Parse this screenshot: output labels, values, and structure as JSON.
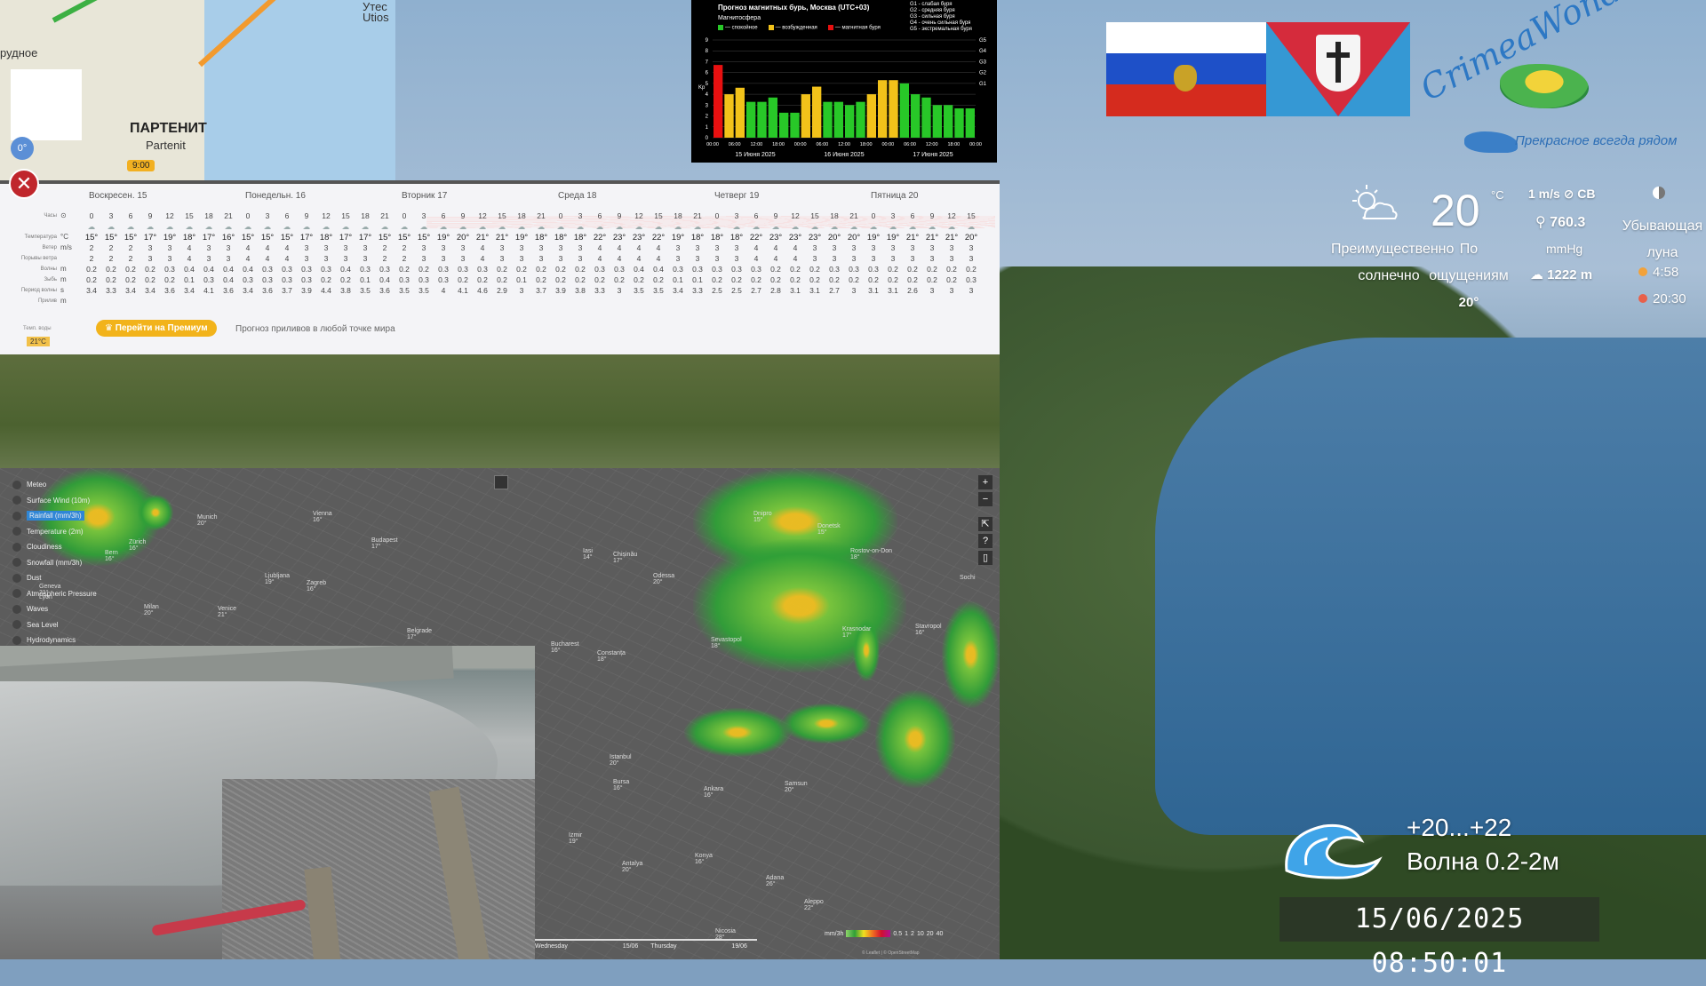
{
  "map": {
    "labels": {
      "town": "ПАРТЕНИТ",
      "town_latin": "Partenit",
      "left_label": "рудное",
      "right_label": "Утес",
      "right_label2": "Utios"
    },
    "temperature": "0°",
    "time_tag": "9:00"
  },
  "kp_chart": {
    "title": "Прогноз магнитных бурь, Москва (UTC+03)",
    "subtitle": "Магнитосфера",
    "legend": [
      "— спокойное",
      "— возбужденная",
      "— магнитная буря"
    ],
    "storm_levels": [
      "G1 - слабая буря",
      "G2 - средняя буря",
      "G3 - сильная буря",
      "G4 - очень сильная буря",
      "G5 - экстремальная буря"
    ],
    "days": [
      "15 Июня 2025",
      "16 Июня 2025",
      "17 Июня 2025"
    ],
    "chart_data": {
      "type": "bar",
      "ylabel": "Kp",
      "ylim": [
        0,
        9
      ],
      "y_ticks": [
        "0",
        "1",
        "2",
        "3",
        "4",
        "5",
        "6",
        "7",
        "8",
        "9"
      ],
      "right_ticks": [
        "G1",
        "G2",
        "G3",
        "G4",
        "G5"
      ],
      "x_ticks": [
        "00:00",
        "06:00",
        "12:00",
        "18:00",
        "00:00",
        "06:00",
        "12:00",
        "18:00",
        "00:00",
        "06:00",
        "12:00",
        "18:00",
        "00:00"
      ],
      "values": [
        6.7,
        4.0,
        4.6,
        3.3,
        3.3,
        3.7,
        2.3,
        2.3,
        4.0,
        4.7,
        3.3,
        3.3,
        3.0,
        3.3,
        4.0,
        5.3,
        5.3,
        5.0,
        4.0,
        3.7,
        3.0,
        3.0,
        2.7,
        2.7
      ],
      "colors": [
        "#e81010",
        "#f2c21a",
        "#f2c21a",
        "#28c828",
        "#28c828",
        "#28c828",
        "#28c828",
        "#28c828",
        "#f2c21a",
        "#f2c21a",
        "#28c828",
        "#28c828",
        "#28c828",
        "#28c828",
        "#f2c21a",
        "#f2c21a",
        "#f2c21a",
        "#28c828",
        "#28c828",
        "#28c828",
        "#28c828",
        "#28c828",
        "#28c828",
        "#28c828"
      ]
    },
    "palette": {
      "quiet": "#28c828",
      "active": "#f2c21a",
      "storm": "#e81010"
    }
  },
  "forecast": {
    "days": [
      "Воскресен. 15",
      "Понедельн. 16",
      "Вторник 17",
      "Среда 18",
      "Четверг 19",
      "Пятница 20"
    ],
    "row_labels": [
      "Часы",
      "",
      "Температура",
      "Ветер",
      "Порывы ветра",
      "Волны",
      "Зыбь",
      "Период волны",
      "Прилив"
    ],
    "units": [
      "⊙",
      "",
      "°C",
      "m/s",
      "",
      "m",
      "m",
      "s",
      "m"
    ],
    "hours": [
      "0",
      "3",
      "6",
      "9",
      "12",
      "15",
      "18",
      "21",
      "0",
      "3",
      "6",
      "9",
      "12",
      "15",
      "18",
      "21",
      "0",
      "3",
      "6",
      "9",
      "12",
      "15",
      "18",
      "21",
      "0",
      "3",
      "6",
      "9",
      "12",
      "15",
      "18",
      "21",
      "0",
      "3",
      "6",
      "9",
      "12",
      "15",
      "18",
      "21",
      "0",
      "3",
      "6",
      "9",
      "12",
      "15"
    ],
    "temps": [
      "15°",
      "15°",
      "15°",
      "17°",
      "19°",
      "18°",
      "17°",
      "16°",
      "15°",
      "15°",
      "15°",
      "17°",
      "18°",
      "17°",
      "17°",
      "15°",
      "15°",
      "15°",
      "19°",
      "20°",
      "21°",
      "21°",
      "19°",
      "18°",
      "18°",
      "18°",
      "22°",
      "23°",
      "23°",
      "22°",
      "19°",
      "18°",
      "18°",
      "18°",
      "22°",
      "23°",
      "23°",
      "23°",
      "20°",
      "20°",
      "19°",
      "19°",
      "21°",
      "21°",
      "21°",
      "20°"
    ],
    "wind": [
      "2",
      "2",
      "2",
      "3",
      "3",
      "4",
      "3",
      "3",
      "4",
      "4",
      "4",
      "3",
      "3",
      "3",
      "3",
      "2",
      "2",
      "3",
      "3",
      "3",
      "4",
      "3",
      "3",
      "3",
      "3",
      "3",
      "4",
      "4",
      "4",
      "4",
      "3",
      "3",
      "3",
      "3",
      "4",
      "4",
      "4",
      "3",
      "3",
      "3",
      "3",
      "3",
      "3",
      "3",
      "3",
      "3"
    ],
    "waves": [
      "0.2",
      "0.2",
      "0.2",
      "0.2",
      "0.3",
      "0.4",
      "0.4",
      "0.4",
      "0.4",
      "0.3",
      "0.3",
      "0.3",
      "0.3",
      "0.4",
      "0.3",
      "0.3",
      "0.2",
      "0.2",
      "0.3",
      "0.3",
      "0.3",
      "0.2",
      "0.2",
      "0.2",
      "0.2",
      "0.2",
      "0.3",
      "0.3",
      "0.4",
      "0.4",
      "0.3",
      "0.3",
      "0.3",
      "0.3",
      "0.3",
      "0.2",
      "0.2",
      "0.2",
      "0.3",
      "0.3",
      "0.3",
      "0.2",
      "0.2",
      "0.2",
      "0.2",
      "0.2"
    ],
    "swell": [
      "0.2",
      "0.2",
      "0.2",
      "0.2",
      "0.2",
      "0.1",
      "0.3",
      "0.4",
      "0.3",
      "0.3",
      "0.3",
      "0.3",
      "0.2",
      "0.2",
      "0.1",
      "0.4",
      "0.3",
      "0.3",
      "0.3",
      "0.2",
      "0.2",
      "0.2",
      "0.1",
      "0.2",
      "0.2",
      "0.2",
      "0.2",
      "0.2",
      "0.2",
      "0.2",
      "0.1",
      "0.1",
      "0.2",
      "0.2",
      "0.2",
      "0.2",
      "0.2",
      "0.2",
      "0.2",
      "0.2",
      "0.2",
      "0.2",
      "0.2",
      "0.2",
      "0.2",
      "0.3"
    ],
    "period": [
      "3.4",
      "3.3",
      "3.4",
      "3.4",
      "3.6",
      "3.4",
      "4.1",
      "3.6",
      "3.4",
      "3.6",
      "3.7",
      "3.9",
      "4.4",
      "3.8",
      "3.5",
      "3.6",
      "3.5",
      "3.5",
      "4",
      "4.1",
      "4.6",
      "2.9",
      "3",
      "3.7",
      "3.9",
      "3.8",
      "3.3",
      "3",
      "3.5",
      "3.5",
      "3.4",
      "3.3",
      "2.5",
      "2.5",
      "2.7",
      "2.8",
      "3.1",
      "3.1",
      "2.7",
      "3",
      "3.1",
      "3.1",
      "2.6",
      "3",
      "3",
      "3"
    ],
    "premium_button": "Перейти на Премиум",
    "premium_note": "Прогноз приливов в любой точке мира",
    "water_label": "Темп. воды",
    "water_temp": "21°C"
  },
  "logos": {
    "crimea_word": "CrimeaWonderland",
    "slogan": "Прекрасное всегда рядом"
  },
  "weather": {
    "condition": "Преимущественно солнечно",
    "temp": "20",
    "temp_unit": "°C",
    "feels_label": "По ощущениям",
    "feels_value": "20°",
    "wind": "1 m/s ⊘ СВ",
    "pressure": "760.3",
    "pressure_unit": "mmHg",
    "altitude": "1222 m",
    "moon": "Убывающая луна",
    "sunrise": "4:58",
    "sunset": "20:30"
  },
  "rain_map": {
    "layers": [
      "Meteo",
      "Surface Wind (10m)",
      "Rainfall (mm/3h)",
      "Temperature (2m)",
      "Cloudiness",
      "Snowfall (mm/3h)",
      "Dust",
      "Atmospheric Pressure",
      "Waves",
      "Sea Level",
      "Hydrodynamics"
    ],
    "active_layer": "Rainfall (mm/3h)",
    "cities": [
      {
        "name": "Munich",
        "t": "20°"
      },
      {
        "name": "Vienna",
        "t": "16°"
      },
      {
        "name": "Budapest",
        "t": "17°"
      },
      {
        "name": "Zürich",
        "t": "16°"
      },
      {
        "name": "Bern",
        "t": "16°"
      },
      {
        "name": "Ljubljana",
        "t": "19°"
      },
      {
        "name": "Zagreb",
        "t": "16°"
      },
      {
        "name": "Milan",
        "t": "20°"
      },
      {
        "name": "Venice",
        "t": "21°"
      },
      {
        "name": "Belgrade",
        "t": "17°"
      },
      {
        "name": "Geneva",
        "t": "21°"
      },
      {
        "name": "Lyon",
        "t": ""
      },
      {
        "name": "Iasi",
        "t": "14°"
      },
      {
        "name": "Chișinău",
        "t": "17°"
      },
      {
        "name": "Odessa",
        "t": "20°"
      },
      {
        "name": "Dnipro",
        "t": "15°"
      },
      {
        "name": "Donetsk",
        "t": "15°"
      },
      {
        "name": "Rostov-on-Don",
        "t": "18°"
      },
      {
        "name": "Krasnodar",
        "t": "17°"
      },
      {
        "name": "Stavropol",
        "t": "16°"
      },
      {
        "name": "Sevastopol",
        "t": "18°"
      },
      {
        "name": "Bucharest",
        "t": "16°"
      },
      {
        "name": "Constanța",
        "t": "18°"
      },
      {
        "name": "Istanbul",
        "t": "20°"
      },
      {
        "name": "Ankara",
        "t": "16°"
      },
      {
        "name": "Samsun",
        "t": "20°"
      },
      {
        "name": "Bursa",
        "t": "16°"
      },
      {
        "name": "Izmir",
        "t": "19°"
      },
      {
        "name": "Konya",
        "t": "16°"
      },
      {
        "name": "Adana",
        "t": "26°"
      },
      {
        "name": "Aleppo",
        "t": "22°"
      },
      {
        "name": "Nicosia",
        "t": "28°"
      },
      {
        "name": "Antalya",
        "t": "20°"
      },
      {
        "name": "Sochi",
        "t": ""
      }
    ],
    "timeline": [
      "Wednesday",
      "15/06",
      "Thursday",
      "19/06"
    ],
    "scale_label": "mm/3h",
    "scale_ticks": [
      "0.5",
      "1",
      "2",
      "10",
      "20",
      "40"
    ],
    "copyright": "© Leaflet | © OpenStreetMap"
  },
  "sea": {
    "temp": "+20...+22",
    "wave": "Волна 0.2-2м"
  },
  "clock": "15/06/2025 08:50:01"
}
